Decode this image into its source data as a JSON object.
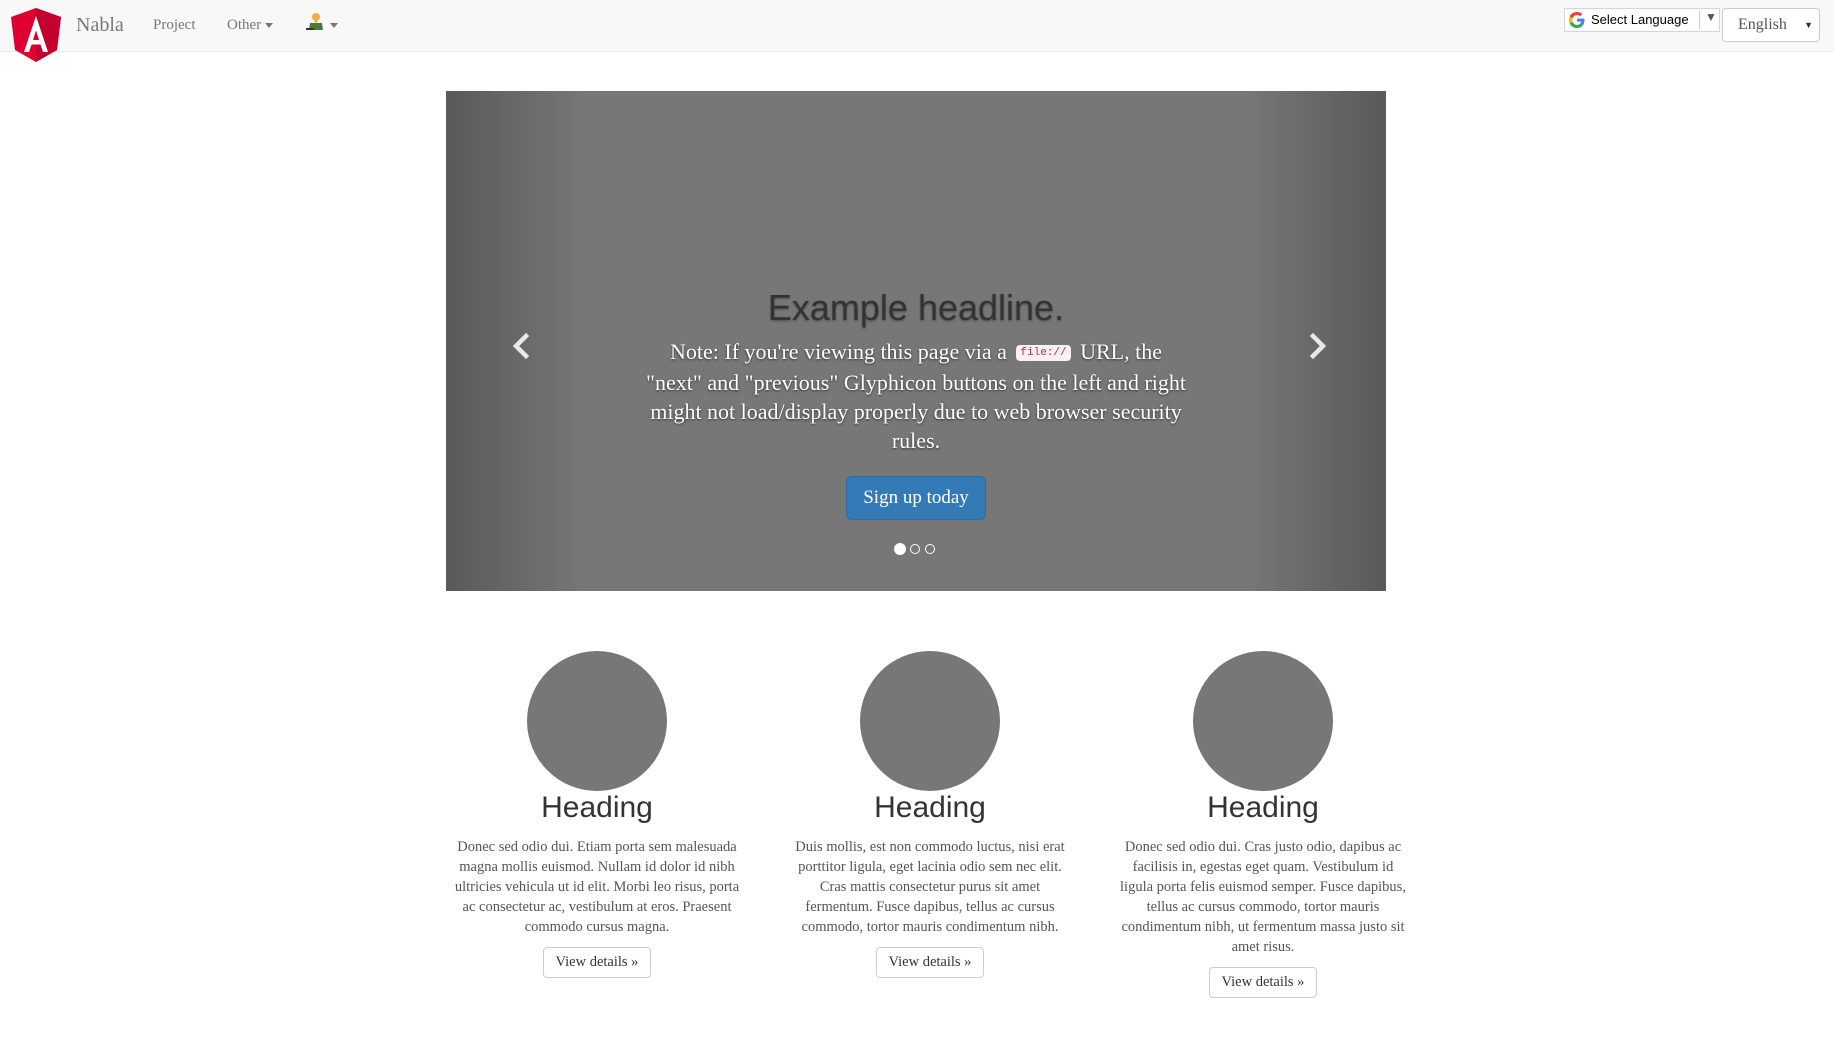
{
  "navbar": {
    "brand": "Nabla",
    "links": [
      {
        "label": "Project"
      },
      {
        "label": "Other"
      }
    ],
    "user_icon": "user-icon"
  },
  "translate": {
    "label": "Select Language",
    "icon": "google-g-icon",
    "arrow": "▼"
  },
  "language": {
    "selected": "English",
    "arrow": "▼"
  },
  "carousel": {
    "headline": "Example headline.",
    "note_before": "Note: If you're viewing this page via a",
    "note_code": "file://",
    "note_after": "URL, the \"next\" and \"previous\" Glyphicon buttons on the left and right might not load/display properly due to web browser security rules.",
    "cta": "Sign up today",
    "slides_count": 3,
    "active_slide": 1,
    "prev_icon": "chevron-left-icon",
    "next_icon": "chevron-right-icon"
  },
  "columns": [
    {
      "heading": "Heading",
      "text": "Donec sed odio dui. Etiam porta sem malesuada magna mollis euismod. Nullam id dolor id nibh ultricies vehicula ut id elit. Morbi leo risus, porta ac consectetur ac, vestibulum at eros. Praesent commodo cursus magna.",
      "button": "View details »"
    },
    {
      "heading": "Heading",
      "text": "Duis mollis, est non commodo luctus, nisi erat porttitor ligula, eget lacinia odio sem nec elit. Cras mattis consectetur purus sit amet fermentum. Fusce dapibus, tellus ac cursus commodo, tortor mauris condimentum nibh.",
      "button": "View details »"
    },
    {
      "heading": "Heading",
      "text": "Donec sed odio dui. Cras justo odio, dapibus ac facilisis in, egestas eget quam. Vestibulum id ligula porta felis euismod semper. Fusce dapibus, tellus ac cursus commodo, tortor mauris condimentum nibh, ut fermentum massa justo sit amet risus.",
      "button": "View details »"
    }
  ],
  "colors": {
    "primary": "#337ab7",
    "placeholder_gray": "#777777",
    "logo_red": "#dd0031"
  }
}
